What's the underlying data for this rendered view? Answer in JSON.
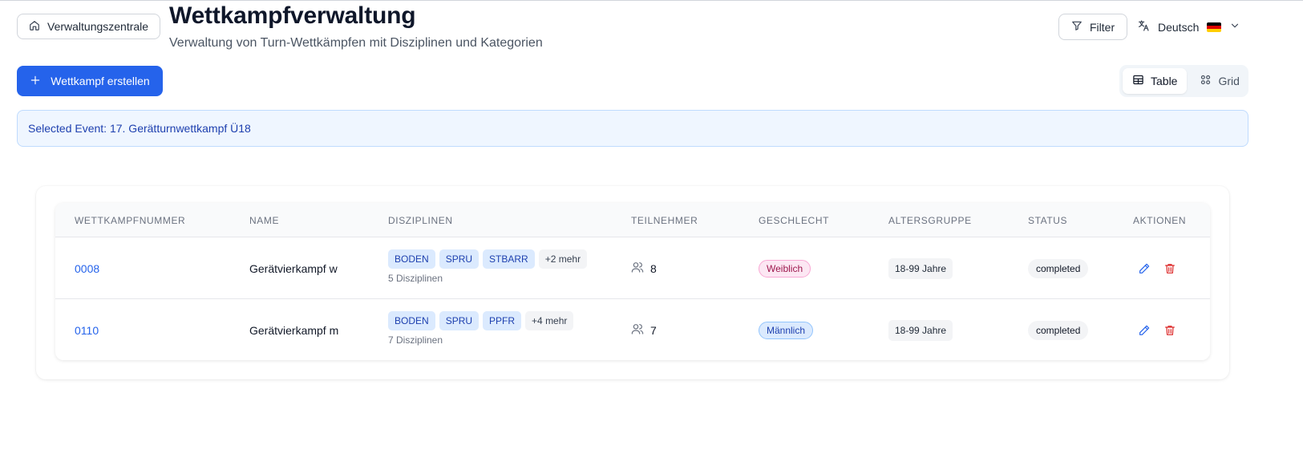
{
  "header": {
    "home_label": "Verwaltungszentrale",
    "title": "Wettkampfverwaltung",
    "subtitle": "Verwaltung von Turn-Wettkämpfen mit Disziplinen und Kategorien",
    "filter_label": "Filter",
    "language": "Deutsch"
  },
  "toolbar": {
    "create_label": "Wettkampf erstellen",
    "view_table": "Table",
    "view_grid": "Grid",
    "active_view": "Table"
  },
  "banner": {
    "text": "Selected Event: 17. Gerätturnwettkampf Ü18"
  },
  "table": {
    "columns": [
      "WETTKAMPFNUMMER",
      "NAME",
      "DISZIPLINEN",
      "TEILNEHMER",
      "GESCHLECHT",
      "ALTERSGRUPPE",
      "STATUS",
      "AKTIONEN"
    ],
    "rows": [
      {
        "number": "0008",
        "name": "Gerätvierkampf w",
        "disciplines": [
          "BODEN",
          "SPRU",
          "STBARR"
        ],
        "more": "+2 mehr",
        "discipline_count": "5 Disziplinen",
        "participants": "8",
        "gender": "Weiblich",
        "age_group": "18-99 Jahre",
        "status": "completed"
      },
      {
        "number": "0110",
        "name": "Gerätvierkampf m",
        "disciplines": [
          "BODEN",
          "SPRU",
          "PPFR"
        ],
        "more": "+4 mehr",
        "discipline_count": "7 Disziplinen",
        "participants": "7",
        "gender": "Männlich",
        "age_group": "18-99 Jahre",
        "status": "completed"
      }
    ]
  },
  "colors": {
    "primary": "#2563eb",
    "female_badge": "#fce7f3",
    "male_badge": "#dbeafe",
    "delete": "#dc2626"
  }
}
